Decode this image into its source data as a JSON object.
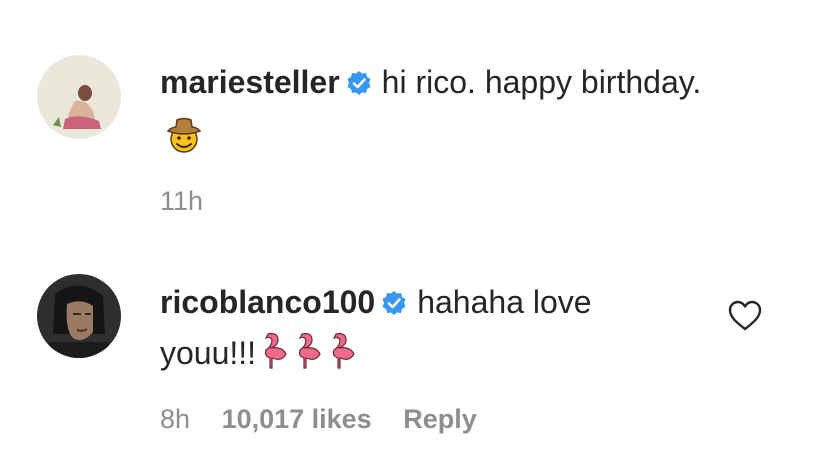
{
  "comments": [
    {
      "username": "mariesteller",
      "verified": true,
      "text": "hi rico. happy birthday.",
      "emoji": "cowboy-face",
      "time": "11h"
    },
    {
      "username": "ricoblanco100",
      "verified": true,
      "text_line1": "hahaha love",
      "text_line2": "youu!!!",
      "emoji": "flamingo x3",
      "time": "8h",
      "likes": "10,017 likes",
      "reply_label": "Reply"
    }
  ],
  "icons": {
    "verified": "verified-badge-icon",
    "like": "heart-outline-icon"
  },
  "colors": {
    "verified_blue": "#3897f0",
    "meta_gray": "#8e8e8e",
    "text": "#262626"
  }
}
